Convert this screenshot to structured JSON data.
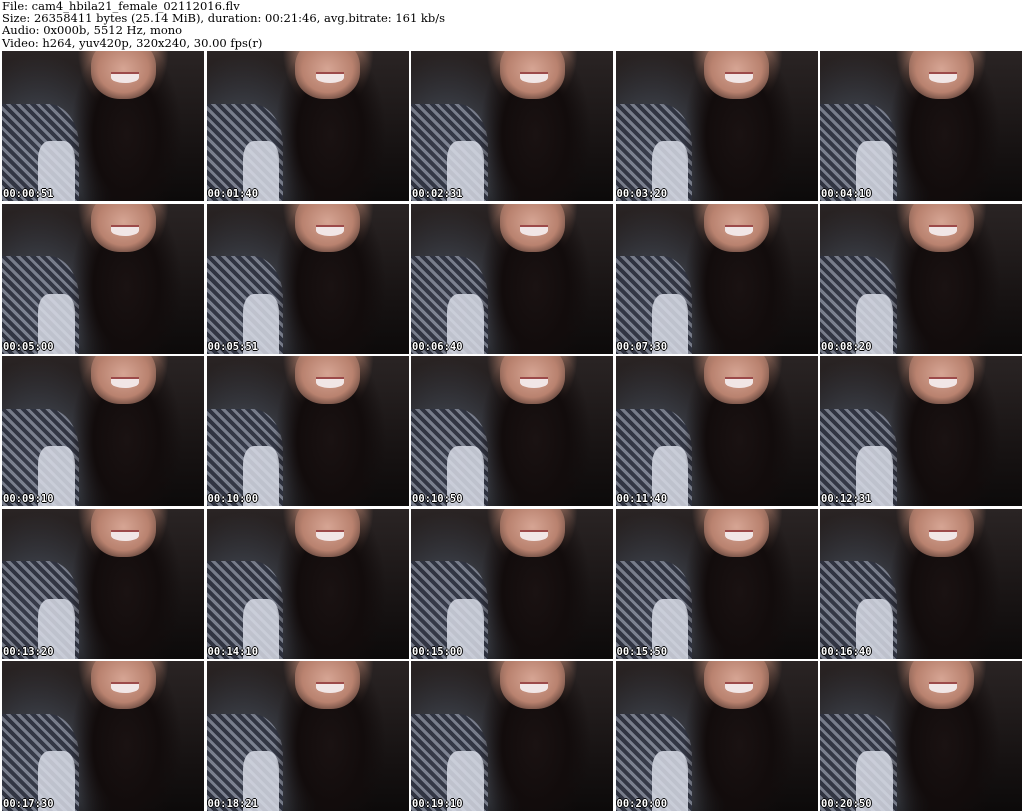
{
  "header": {
    "file_line": "File: cam4_hbila21_female_02112016.flv",
    "size_line": "Size: 26358411 bytes (25.14 MiB), duration: 00:21:46, avg.bitrate: 161 kb/s",
    "audio_line": "Audio: 0x000b, 5512 Hz, mono",
    "video_line": "Video: h264, yuv420p, 320x240, 30.00 fps(r)"
  },
  "thumbnails": [
    {
      "timestamp": "00:00:51"
    },
    {
      "timestamp": "00:01:40"
    },
    {
      "timestamp": "00:02:31"
    },
    {
      "timestamp": "00:03:20"
    },
    {
      "timestamp": "00:04:10"
    },
    {
      "timestamp": "00:05:00"
    },
    {
      "timestamp": "00:05:51"
    },
    {
      "timestamp": "00:06:40"
    },
    {
      "timestamp": "00:07:30"
    },
    {
      "timestamp": "00:08:20"
    },
    {
      "timestamp": "00:09:10"
    },
    {
      "timestamp": "00:10:00"
    },
    {
      "timestamp": "00:10:50"
    },
    {
      "timestamp": "00:11:40"
    },
    {
      "timestamp": "00:12:31"
    },
    {
      "timestamp": "00:13:20"
    },
    {
      "timestamp": "00:14:10"
    },
    {
      "timestamp": "00:15:00"
    },
    {
      "timestamp": "00:15:50"
    },
    {
      "timestamp": "00:16:40"
    },
    {
      "timestamp": "00:17:30"
    },
    {
      "timestamp": "00:18:21"
    },
    {
      "timestamp": "00:19:10"
    },
    {
      "timestamp": "00:20:00"
    },
    {
      "timestamp": "00:20:50"
    }
  ]
}
